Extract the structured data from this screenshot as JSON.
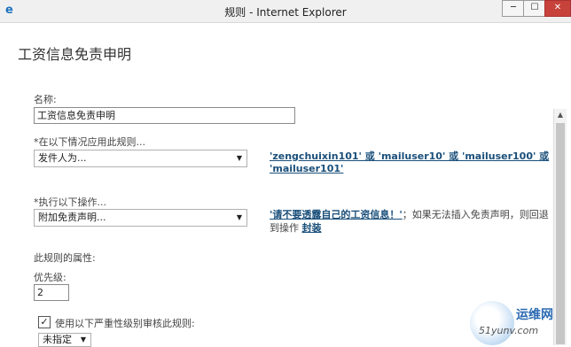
{
  "window": {
    "title": "规则 - Internet Explorer",
    "min_label": "─",
    "max_label": "☐",
    "close_label": "✕"
  },
  "page": {
    "title": "工资信息免责申明"
  },
  "name_field": {
    "label": "名称:",
    "value": "工资信息免责申明"
  },
  "condition": {
    "label": "*在以下情况应用此规则...",
    "selected": "发件人为...",
    "link_line1": "'zengchuixin101' 或 'mailuser10' 或 'mailuser100' 或",
    "link_line2": "'mailuser101'"
  },
  "action": {
    "label": "*执行以下操作...",
    "selected": "附加免责声明...",
    "link": "'请不要透露自己的工资信息！'",
    "note1": "；如果无法插入免责声明，则回退",
    "note2": "到操作",
    "fallback_link": "封装"
  },
  "properties": {
    "label": "此规则的属性:",
    "priority_label": "优先级:",
    "priority_value": "2",
    "audit_label": "使用以下严重性级别审核此规则:",
    "audit_checked": true,
    "severity_selected": "未指定"
  },
  "watermark": {
    "text": "运维网",
    "url": "51yunv.com"
  },
  "icons": [
    "app-icon",
    "dropdown-arrow-icon",
    "scroll-up-icon",
    "checkmark-icon"
  ]
}
